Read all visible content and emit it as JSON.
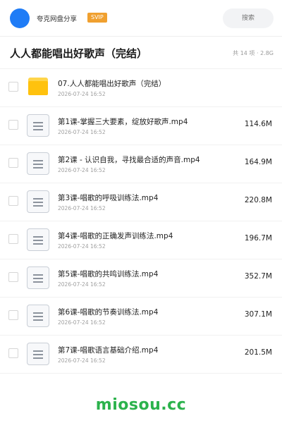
{
  "header": {
    "app_name": "夸克网盘分享",
    "badge": "SVIP",
    "search_placeholder": "搜索"
  },
  "folder": {
    "title": "人人都能唱出好歌声（完结）",
    "meta": "共 14 项 · 2.8G"
  },
  "items": [
    {
      "type": "folder",
      "icon": "folder-icon",
      "name": "07.人人都能唱出好歌声（完结）",
      "date": "2026-07-24 16:52",
      "size": ""
    },
    {
      "type": "file",
      "icon": "file-icon",
      "name": "第1课-掌握三大要素，绽放好歌声.mp4",
      "date": "2026-07-24 16:52",
      "size": "114.6M"
    },
    {
      "type": "file",
      "icon": "file-icon",
      "name": "第2课 - 认识自我，寻找最合适的声音.mp4",
      "date": "2026-07-24 16:52",
      "size": "164.9M"
    },
    {
      "type": "file",
      "icon": "file-icon",
      "name": "第3课-唱歌的呼吸训练法.mp4",
      "date": "2026-07-24 16:52",
      "size": "220.8M"
    },
    {
      "type": "file",
      "icon": "file-icon",
      "name": "第4课-唱歌的正确发声训练法.mp4",
      "date": "2026-07-24 16:52",
      "size": "196.7M"
    },
    {
      "type": "file",
      "icon": "file-icon",
      "name": "第5课-唱歌的共鸣训练法.mp4",
      "date": "2026-07-24 16:52",
      "size": "352.7M"
    },
    {
      "type": "file",
      "icon": "file-icon",
      "name": "第6课-唱歌的节奏训练法.mp4",
      "date": "2026-07-24 16:52",
      "size": "307.1M"
    },
    {
      "type": "file",
      "icon": "file-icon",
      "name": "第7课-唱歌语言基础介绍.mp4",
      "date": "2026-07-24 16:52",
      "size": "201.5M"
    }
  ],
  "watermark": "miosou.cc",
  "colors": {
    "accent": "#1f7cf6",
    "svip": "#f0a02f",
    "folder": "#ffc20e",
    "watermark": "#2bb24c"
  }
}
